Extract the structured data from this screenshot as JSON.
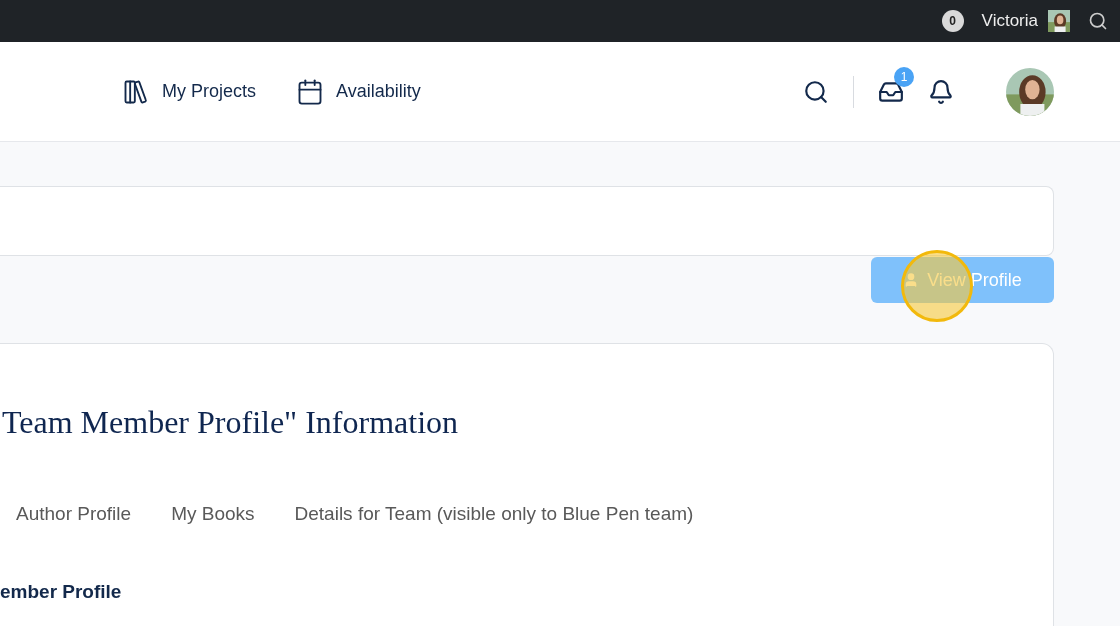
{
  "top_bar": {
    "count": "0",
    "user": "Victoria"
  },
  "nav": {
    "links": [
      {
        "label": "My Projects",
        "kind": "books"
      },
      {
        "label": "Availability",
        "kind": "calendar"
      }
    ],
    "inbox_badge": "1"
  },
  "action": {
    "label": "View Profile",
    "click_marker": true
  },
  "section": {
    "title": "Team Member Profile\" Information",
    "tabs": [
      {
        "label": "Author Profile",
        "selected": false
      },
      {
        "label": "My Books",
        "selected": false
      },
      {
        "label": "Details for Team (visible only to Blue Pen team)",
        "selected": false
      }
    ],
    "subheading": "ember Profile"
  }
}
